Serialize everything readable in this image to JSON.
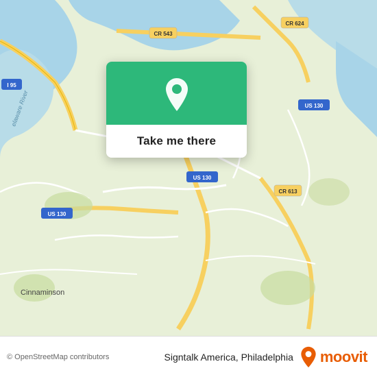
{
  "map": {
    "attribution": "© OpenStreetMap contributors"
  },
  "popup": {
    "button_label": "Take me there"
  },
  "app": {
    "name": "Signtalk America, Philadelphia",
    "brand": "moovit"
  },
  "labels": {
    "cr624": "CR 624",
    "cr543": "CR 543",
    "cr613": "CR 613",
    "us130_1": "US 130",
    "us130_2": "US 130",
    "us130_3": "US 130",
    "i95": "I 95",
    "cinnaminson": "Cinnaminson",
    "delaware_river": "elaware River"
  },
  "icons": {
    "pin": "location-pin-icon",
    "moovit_pin": "moovit-logo-icon"
  }
}
